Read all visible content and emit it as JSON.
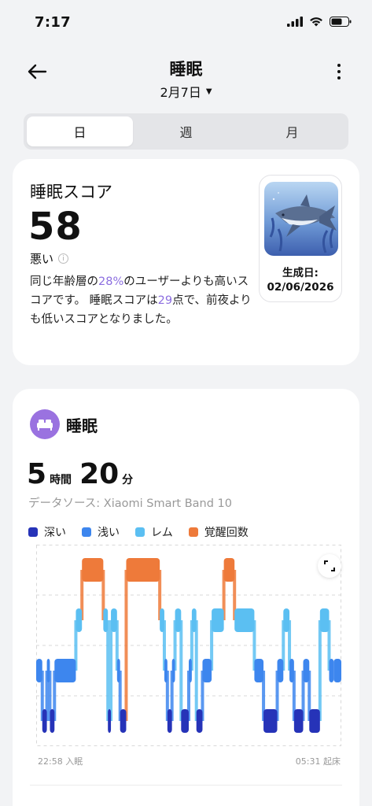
{
  "status": {
    "time": "7:17"
  },
  "nav": {
    "title": "睡眠",
    "date": "2月7日"
  },
  "tabs": [
    "日",
    "週",
    "月"
  ],
  "active_tab": 0,
  "score": {
    "title": "睡眠スコア",
    "value": "58",
    "level": "悪い",
    "desc_pre": "同じ年齢層の",
    "desc_pct": "28%",
    "desc_mid": "のユーザーよりも高いスコアです。 睡眠スコアは",
    "desc_score": "29",
    "desc_post": "点で、前夜よりも低いスコアとなりました。",
    "badge_label": "生成日:",
    "badge_date": "02/06/2026"
  },
  "sleep": {
    "title": "睡眠",
    "hours": "5",
    "hours_unit": "時間",
    "minutes": "20",
    "minutes_unit": "分",
    "data_source": "データソース: Xiaomi Smart Band 10",
    "start_label": "22:58 入眠",
    "end_label": "05:31 起床"
  },
  "colors": {
    "deep": "#2633b8",
    "light": "#3d86ee",
    "rem": "#5bbff2",
    "awake": "#ee7a3a",
    "accent": "#9a72e0"
  },
  "chart_data": {
    "type": "sleep-stage-timeline",
    "legend": [
      "深い",
      "浅い",
      "レム",
      "覚醒回数"
    ],
    "stages": [
      "覚醒回数",
      "レム",
      "浅い",
      "深い"
    ],
    "x_range": [
      "22:58",
      "05:31"
    ],
    "segments": [
      {
        "start": 0.0,
        "end": 0.02,
        "stage": "浅い"
      },
      {
        "start": 0.02,
        "end": 0.035,
        "stage": "深い"
      },
      {
        "start": 0.035,
        "end": 0.045,
        "stage": "浅い"
      },
      {
        "start": 0.045,
        "end": 0.06,
        "stage": "深い"
      },
      {
        "start": 0.06,
        "end": 0.13,
        "stage": "浅い"
      },
      {
        "start": 0.13,
        "end": 0.15,
        "stage": "レム"
      },
      {
        "start": 0.15,
        "end": 0.22,
        "stage": "覚醒回数"
      },
      {
        "start": 0.22,
        "end": 0.235,
        "stage": "レム"
      },
      {
        "start": 0.235,
        "end": 0.245,
        "stage": "深い"
      },
      {
        "start": 0.245,
        "end": 0.265,
        "stage": "レム"
      },
      {
        "start": 0.265,
        "end": 0.275,
        "stage": "浅い"
      },
      {
        "start": 0.275,
        "end": 0.295,
        "stage": "深い"
      },
      {
        "start": 0.295,
        "end": 0.405,
        "stage": "覚醒回数"
      },
      {
        "start": 0.405,
        "end": 0.42,
        "stage": "レム"
      },
      {
        "start": 0.42,
        "end": 0.43,
        "stage": "浅い"
      },
      {
        "start": 0.43,
        "end": 0.445,
        "stage": "深い"
      },
      {
        "start": 0.445,
        "end": 0.455,
        "stage": "浅い"
      },
      {
        "start": 0.455,
        "end": 0.475,
        "stage": "レム"
      },
      {
        "start": 0.475,
        "end": 0.5,
        "stage": "深い"
      },
      {
        "start": 0.5,
        "end": 0.51,
        "stage": "浅い"
      },
      {
        "start": 0.51,
        "end": 0.525,
        "stage": "レム"
      },
      {
        "start": 0.525,
        "end": 0.545,
        "stage": "深い"
      },
      {
        "start": 0.545,
        "end": 0.575,
        "stage": "浅い"
      },
      {
        "start": 0.575,
        "end": 0.615,
        "stage": "レム"
      },
      {
        "start": 0.615,
        "end": 0.65,
        "stage": "覚醒回数"
      },
      {
        "start": 0.65,
        "end": 0.715,
        "stage": "レム"
      },
      {
        "start": 0.715,
        "end": 0.745,
        "stage": "浅い"
      },
      {
        "start": 0.745,
        "end": 0.79,
        "stage": "深い"
      },
      {
        "start": 0.79,
        "end": 0.81,
        "stage": "浅い"
      },
      {
        "start": 0.81,
        "end": 0.83,
        "stage": "レム"
      },
      {
        "start": 0.83,
        "end": 0.845,
        "stage": "浅い"
      },
      {
        "start": 0.845,
        "end": 0.875,
        "stage": "深い"
      },
      {
        "start": 0.875,
        "end": 0.895,
        "stage": "浅い"
      },
      {
        "start": 0.895,
        "end": 0.93,
        "stage": "深い"
      },
      {
        "start": 0.93,
        "end": 0.96,
        "stage": "レム"
      },
      {
        "start": 0.96,
        "end": 0.975,
        "stage": "浅い"
      },
      {
        "start": 0.975,
        "end": 1.0,
        "stage": "浅い"
      }
    ]
  }
}
